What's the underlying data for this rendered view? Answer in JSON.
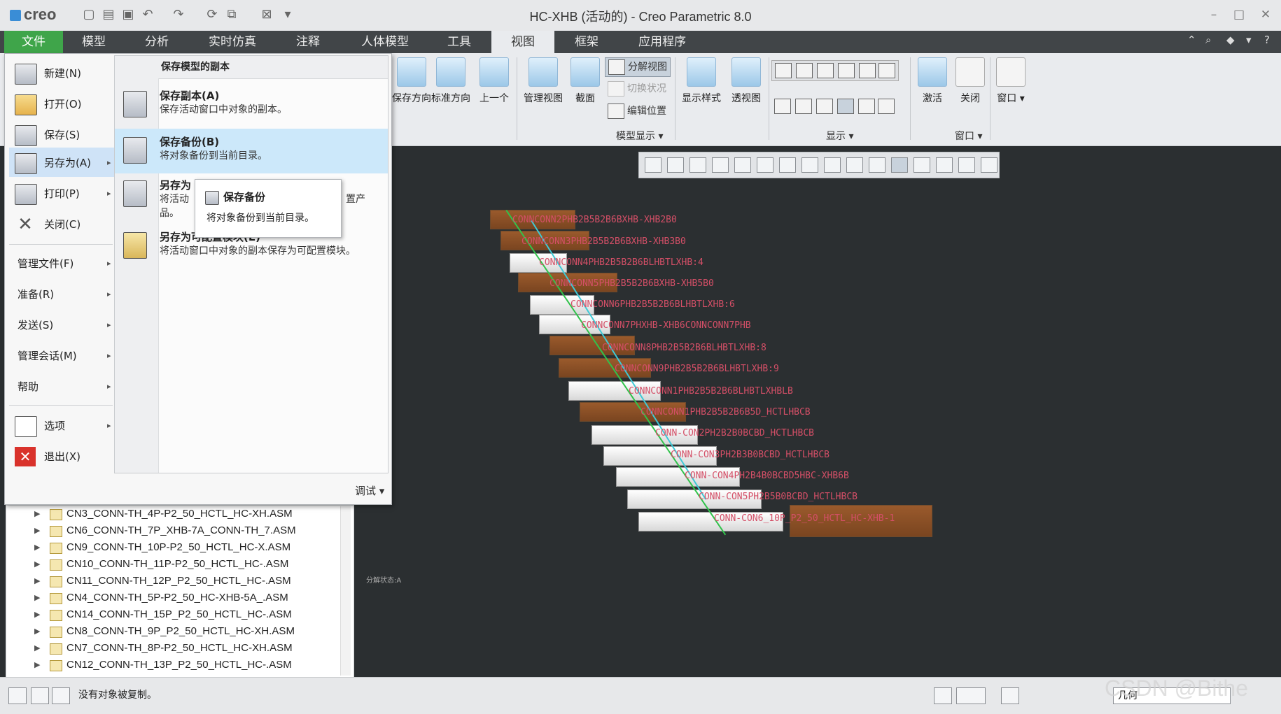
{
  "app": {
    "logo": "creo",
    "window_title": "HC-XHB (活动的) - Creo Parametric 8.0",
    "controls": {
      "minimize": "–",
      "maximize": "□",
      "close": "✕"
    }
  },
  "ribbon": {
    "tabs": [
      "文件",
      "模型",
      "分析",
      "实时仿真",
      "注释",
      "人体模型",
      "工具",
      "视图",
      "框架",
      "应用程序"
    ],
    "active_tab": "视图",
    "orientation_group": {
      "save_orientation": "保存方向",
      "standard_orientation": "标准方向",
      "previous": "上一个"
    },
    "model_display_group": {
      "manage_views": "管理视图",
      "section": "截面",
      "exploded_view": "分解视图",
      "toggle_status": "切换状况",
      "edit_position": "编辑位置",
      "group_label": "模型显示 ▾"
    },
    "display_style": "显示样式",
    "perspective": "透视图",
    "display_group_label": "显示 ▾",
    "activate": "激活",
    "close": "关闭",
    "window": "窗口",
    "window_group_label": "窗口 ▾"
  },
  "file_menu": {
    "left_items": [
      {
        "label": "新建(N)",
        "icon": "new-file-icon"
      },
      {
        "label": "打开(O)",
        "icon": "open-folder-icon"
      },
      {
        "label": "保存(S)",
        "icon": "save-icon"
      },
      {
        "label": "另存为(A)",
        "icon": "save-as-icon",
        "submenu": "▸"
      },
      {
        "label": "打印(P)",
        "icon": "print-icon",
        "submenu": "▸"
      },
      {
        "label": "关闭(C)",
        "icon": "close-x-icon"
      }
    ],
    "plain_items": [
      {
        "label": "管理文件(F)",
        "submenu": "▸"
      },
      {
        "label": "准备(R)",
        "submenu": "▸"
      },
      {
        "label": "发送(S)",
        "submenu": "▸"
      },
      {
        "label": "管理会话(M)",
        "submenu": "▸"
      },
      {
        "label": "帮助",
        "submenu": "▸"
      }
    ],
    "bottom_items": [
      {
        "label": "选项",
        "icon": "options-icon",
        "submenu": "▸"
      },
      {
        "label": "退出(X)",
        "icon": "exit-icon"
      }
    ],
    "submenu_header": "保存模型的副本",
    "submenu_items": [
      {
        "title": "保存副本(A)",
        "desc": "保存活动窗口中对象的副本。"
      },
      {
        "title": "保存备份(B)",
        "desc": "将对象备份到当前目录。"
      },
      {
        "title": "另存为",
        "desc": "将活动",
        "desc_tail": "置产",
        "desc2": "品。"
      },
      {
        "title": "另存为可配置模块(E)",
        "desc": "将活动窗口中对象的副本保存为可配置模块。"
      }
    ],
    "debug": "调试 ▾"
  },
  "tooltip": {
    "title": "保存备份",
    "desc": "将对象备份到当前目录。"
  },
  "model_tree": {
    "rows": [
      "CN3_CONN-TH_4P-P2_50_HCTL_HC-XH.ASM",
      "CN6_CONN-TH_7P_XHB-7A_CONN-TH_7.ASM",
      "CN9_CONN-TH_10P-P2_50_HCTL_HC-X.ASM",
      "CN10_CONN-TH_11P-P2_50_HCTL_HC-.ASM",
      "CN11_CONN-TH_12P_P2_50_HCTL_HC-.ASM",
      "CN4_CONN-TH_5P-P2_50_HC-XHB-5A_.ASM",
      "CN14_CONN-TH_15P_P2_50_HCTL_HC-.ASM",
      "CN8_CONN-TH_9P_P2_50_HCTL_HC-XH.ASM",
      "CN7_CONN-TH_8P-P2_50_HCTL_HC-XH.ASM",
      "CN12_CONN-TH_13P_P2_50_HCTL_HC-.ASM"
    ]
  },
  "graphics": {
    "labels": [
      "CONNCONN2PHB2B5B2B6BXHB-XHB2B0",
      "CONNCONN3PHB2B5B2B6BXHB-XHB3B0",
      "CONNCONN4PHB2B5B2B6BLHBTLXHB:4",
      "CONNCONN5PHB2B5B2B6BXHB-XHB5B0",
      "CONNCONN6PHB2B5B2B6BLHBTLXHB:6",
      "CONNCONN7PHXHB-XHB6CONNCONN7PHB",
      "CONNCONN8PHB2B5B2B6BLHBTLXHB:8",
      "CONNCONN9PHB2B5B2B6BLHBTLXHB:9",
      "CONNCONN1PHB2B5B2B6BLHBTLXHBLB",
      "CONNCONN1PHB2B5B2B6B5D_HCTLHBCB",
      "CONN-CON2PH2B2B0BCBD_HCTLHBCB",
      "CONN-CON3PH2B3B0BCBD_HCTLHBCB",
      "CONN-CON4PH2B4B0BCBD5HBC-XHB6B",
      "CONN-CON5PH2B5B0BCBD_HCTLHBCB",
      "CONN-CON6_10P_P2_50_HCTL_HC-XHB-1"
    ],
    "small_text": "分解状态:A"
  },
  "status": {
    "message": "没有对象被复制。",
    "filter": "几何"
  },
  "watermark": "CSDN @Bithe"
}
